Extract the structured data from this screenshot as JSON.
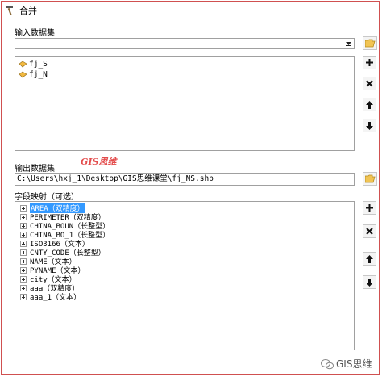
{
  "window": {
    "title": "合并"
  },
  "input_section": {
    "label": "输入数据集",
    "combo_value": "",
    "items": [
      "fj_S",
      "fj_N"
    ]
  },
  "output_section": {
    "label": "输出数据集",
    "path": "C:\\Users\\hxj_1\\Desktop\\GIS思维课堂\\fj_NS.shp"
  },
  "field_map": {
    "label": "字段映射（可选）",
    "fields": [
      "AREA（双精度）",
      "PERIMETER（双精度）",
      "CHINA_BOUN（长整型）",
      "CHINA_BO_1（长整型）",
      "ISO3166（文本）",
      "CNTY_CODE（长整型）",
      "NAME（文本）",
      "PYNAME（文本）",
      "city（文本）",
      "aaa（双精度）",
      "aaa_1（文本）"
    ],
    "selected_index": 0
  },
  "watermark": {
    "middle": "GIS思维",
    "bottom": "GIS思维"
  },
  "colors": {
    "frame": "#d05050",
    "selection": "#3399ff",
    "watermark": "#e34b4b"
  },
  "icons": {
    "title": "hammer-icon",
    "dataset": "dataset-icon",
    "add": "plus-icon",
    "remove": "x-icon",
    "up": "arrow-up-icon",
    "down": "arrow-down-icon",
    "browse": "folder-icon"
  }
}
